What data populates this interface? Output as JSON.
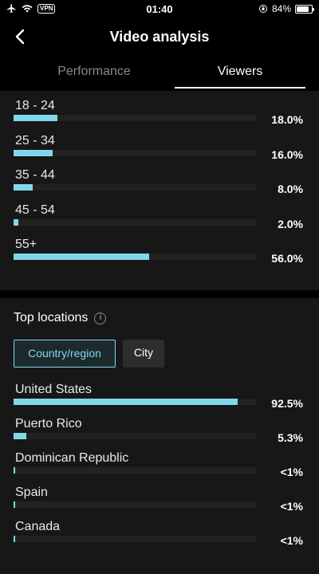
{
  "status": {
    "vpn": "VPN",
    "time": "01:40",
    "battery_text": "84%",
    "battery_level": 0.84
  },
  "nav": {
    "title": "Video analysis"
  },
  "tabs": [
    {
      "label": "Performance",
      "active": false
    },
    {
      "label": "Viewers",
      "active": true
    }
  ],
  "age_groups": [
    {
      "label": "18 - 24",
      "pct": "18.0%",
      "value": 18.0
    },
    {
      "label": "25 - 34",
      "pct": "16.0%",
      "value": 16.0
    },
    {
      "label": "35 - 44",
      "pct": "8.0%",
      "value": 8.0
    },
    {
      "label": "45 - 54",
      "pct": "2.0%",
      "value": 2.0
    },
    {
      "label": "55+",
      "pct": "56.0%",
      "value": 56.0
    }
  ],
  "locations": {
    "heading": "Top locations",
    "filters": [
      {
        "label": "Country/region",
        "active": true
      },
      {
        "label": "City",
        "active": false
      }
    ],
    "items": [
      {
        "label": "United States",
        "pct": "92.5%",
        "value": 92.5
      },
      {
        "label": "Puerto Rico",
        "pct": "5.3%",
        "value": 5.3
      },
      {
        "label": "Dominican Republic",
        "pct": "<1%",
        "value": 0.5
      },
      {
        "label": "Spain",
        "pct": "<1%",
        "value": 0.5
      },
      {
        "label": "Canada",
        "pct": "<1%",
        "value": 0.5
      }
    ]
  },
  "colors": {
    "accent": "#7fd8ea",
    "background": "#000000",
    "panel": "#171717"
  }
}
